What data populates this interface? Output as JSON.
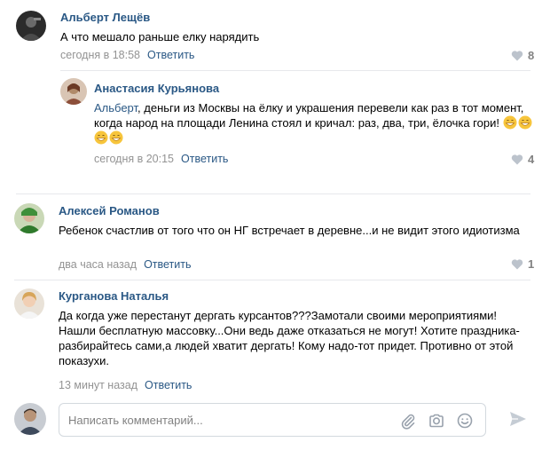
{
  "colors": {
    "link": "#2a5885",
    "meta": "#939393",
    "divider": "#e7e8ec",
    "icon": "#aab2bd"
  },
  "comments": [
    {
      "author": "Альберт Лещёв",
      "text": "А что мешало раньше елку нарядить",
      "time": "сегодня в 18:58",
      "reply_label": "Ответить",
      "likes": "8"
    },
    {
      "author": "Анастасия Курьянова",
      "mention": "Альберт",
      "text": ", деньги из Москвы на ёлку и украшения перевели как раз в тот момент, когда народ на площади Ленина стоял и кричал: раз, два, три, ёлочка гори!",
      "emoji_count": 4,
      "time": "сегодня в 20:15",
      "reply_label": "Ответить",
      "likes": "4"
    },
    {
      "author": "Алексей Романов",
      "text": "Ребенок счастлив от того что он НГ встречает в деревне...и не видит этого идиотизма",
      "time": "два часа назад",
      "reply_label": "Ответить",
      "likes": "1"
    },
    {
      "author": "Курганова Наталья",
      "text": "Да когда уже перестанут дергать курсантов???Замотали своими мероприятиями! Нашли бесплатную массовку...Они ведь даже отказаться не могут! Хотите праздника-разбирайтесь сами,а людей хватит дергать! Кому надо-тот придет. Противно от этой показухи.",
      "time": "13 минут назад",
      "reply_label": "Ответить"
    }
  ],
  "composer": {
    "placeholder": "Написать комментарий...",
    "icons": [
      "paperclip-icon",
      "camera-icon",
      "emoji-icon",
      "send-icon"
    ]
  }
}
